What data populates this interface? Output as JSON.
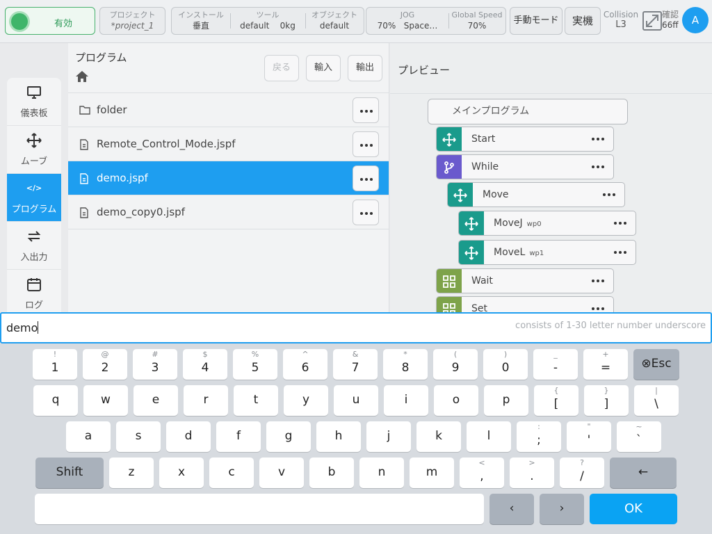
{
  "topbar": {
    "enable_label": "有効",
    "project": {
      "caption": "プロジェクト",
      "value": "*project_1"
    },
    "install": {
      "caption": "インストール",
      "value": "垂直"
    },
    "tool": {
      "caption": "ツール",
      "name": "default",
      "weight": "0kg"
    },
    "object": {
      "caption": "オブジェクト",
      "value": "default"
    },
    "jog": {
      "caption": "JOG",
      "speed": "70%",
      "frame": "Space…"
    },
    "global_speed": {
      "caption": "Global Speed",
      "value": "70%"
    },
    "manual_mode": "手動モード",
    "real_machine": "実機",
    "collision": {
      "caption": "Collision",
      "value": "L3"
    },
    "confirm": {
      "caption": "確認",
      "value": "66ff"
    },
    "avatar_letter": "A"
  },
  "sidenav": {
    "items": [
      {
        "label": "儀表板",
        "icon": "monitor-icon"
      },
      {
        "label": "ムーブ",
        "icon": "move-icon"
      },
      {
        "label": "プログラム",
        "icon": "code-icon",
        "glyph": "</>",
        "active": true
      },
      {
        "label": "入出力",
        "icon": "io-icon"
      },
      {
        "label": "ログ",
        "icon": "calendar-icon"
      }
    ]
  },
  "program": {
    "title": "プログラム",
    "back": "戻る",
    "import": "輸入",
    "export": "輸出",
    "files": [
      {
        "name": "folder",
        "type": "folder"
      },
      {
        "name": "Remote_Control_Mode.jspf",
        "type": "file"
      },
      {
        "name": "demo.jspf",
        "type": "file",
        "selected": true
      },
      {
        "name": "demo_copy0.jspf",
        "type": "file"
      }
    ]
  },
  "preview": {
    "title": "プレビュー",
    "main": "メインプログラム",
    "nodes": [
      {
        "label": "Start",
        "sub": "",
        "color": "#1a9b8c"
      },
      {
        "label": "While",
        "sub": "",
        "color": "#6a5acd"
      },
      {
        "label": "Move",
        "sub": "",
        "color": "#1a9b8c"
      },
      {
        "label": "MoveJ",
        "sub": "wp0",
        "color": "#1a9b8c"
      },
      {
        "label": "MoveL",
        "sub": "wp1",
        "color": "#1a9b8c"
      },
      {
        "label": "Wait",
        "sub": "",
        "color": "#7ea34a"
      },
      {
        "label": "Set",
        "sub": "",
        "color": "#7ea34a"
      }
    ]
  },
  "input": {
    "value": "demo",
    "hint": "consists of 1-30 letter number underscore"
  },
  "keyboard": {
    "row1": [
      {
        "alt": "!",
        "main": "1"
      },
      {
        "alt": "@",
        "main": "2"
      },
      {
        "alt": "#",
        "main": "3"
      },
      {
        "alt": "$",
        "main": "4"
      },
      {
        "alt": "%",
        "main": "5"
      },
      {
        "alt": "^",
        "main": "6"
      },
      {
        "alt": "&",
        "main": "7"
      },
      {
        "alt": "*",
        "main": "8"
      },
      {
        "alt": "(",
        "main": "9"
      },
      {
        "alt": ")",
        "main": "0"
      },
      {
        "alt": "_",
        "main": "-"
      },
      {
        "alt": "+",
        "main": "="
      }
    ],
    "esc": "⊗Esc",
    "row2": [
      {
        "alt": "",
        "main": "q"
      },
      {
        "alt": "",
        "main": "w"
      },
      {
        "alt": "",
        "main": "e"
      },
      {
        "alt": "",
        "main": "r"
      },
      {
        "alt": "",
        "main": "t"
      },
      {
        "alt": "",
        "main": "y"
      },
      {
        "alt": "",
        "main": "u"
      },
      {
        "alt": "",
        "main": "i"
      },
      {
        "alt": "",
        "main": "o"
      },
      {
        "alt": "",
        "main": "p"
      },
      {
        "alt": "{",
        "main": "["
      },
      {
        "alt": "}",
        "main": "]"
      },
      {
        "alt": "|",
        "main": "\\"
      }
    ],
    "row3": [
      {
        "alt": "",
        "main": "a"
      },
      {
        "alt": "",
        "main": "s"
      },
      {
        "alt": "",
        "main": "d"
      },
      {
        "alt": "",
        "main": "f"
      },
      {
        "alt": "",
        "main": "g"
      },
      {
        "alt": "",
        "main": "h"
      },
      {
        "alt": "",
        "main": "j"
      },
      {
        "alt": "",
        "main": "k"
      },
      {
        "alt": "",
        "main": "l"
      },
      {
        "alt": ":",
        "main": ";"
      },
      {
        "alt": "\"",
        "main": "'"
      },
      {
        "alt": "~",
        "main": "`"
      }
    ],
    "shift": "Shift",
    "row4": [
      {
        "alt": "",
        "main": "z"
      },
      {
        "alt": "",
        "main": "x"
      },
      {
        "alt": "",
        "main": "c"
      },
      {
        "alt": "",
        "main": "v"
      },
      {
        "alt": "",
        "main": "b"
      },
      {
        "alt": "",
        "main": "n"
      },
      {
        "alt": "",
        "main": "m"
      },
      {
        "alt": "<",
        "main": ","
      },
      {
        "alt": ">",
        "main": "."
      },
      {
        "alt": "?",
        "main": "/"
      }
    ],
    "backspace": "←",
    "left_arrow": "‹",
    "right_arrow": "›",
    "ok": "OK"
  },
  "colors": {
    "accent": "#1e9ef0",
    "enable_green": "#3fb56a",
    "ok_blue": "#0aa3f3"
  }
}
